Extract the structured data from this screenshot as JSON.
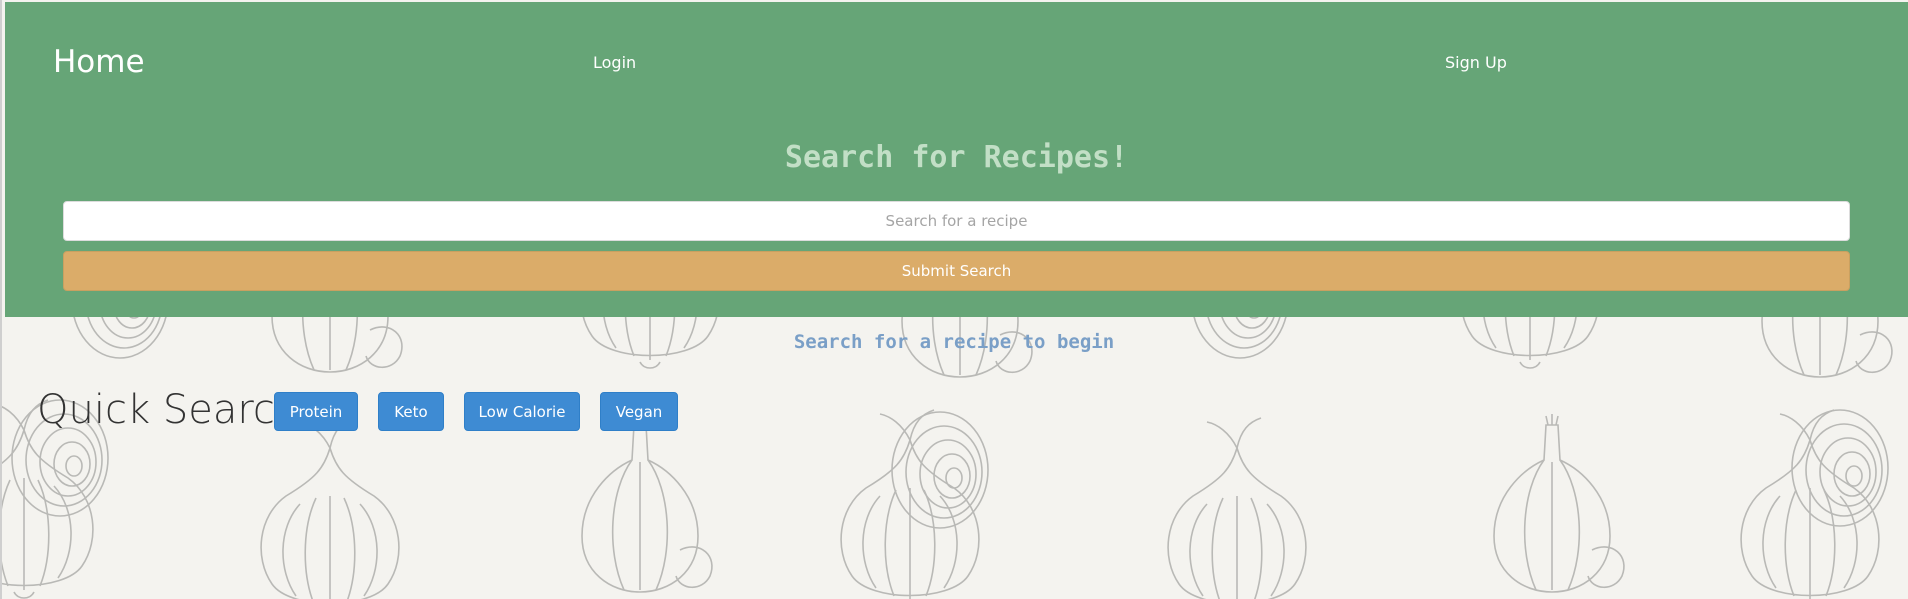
{
  "nav": {
    "brand": "Home",
    "login": "Login",
    "signup": "Sign Up"
  },
  "search": {
    "title": "Search for Recipes!",
    "placeholder": "Search for a recipe",
    "value": "",
    "submit_label": "Submit Search"
  },
  "results": {
    "hint": "Search for a recipe to begin"
  },
  "quick_search": {
    "label": "Quick Search:",
    "buttons": [
      "Protein",
      "Keto",
      "Low Calorie",
      "Vegan"
    ]
  },
  "colors": {
    "header_bg": "#66a577",
    "submit_bg": "#dbac69",
    "quick_btn_bg": "#3e8bd3",
    "page_bg": "#f4f3ef",
    "hint_text": "#7a9fc7"
  },
  "background": {
    "icons": [
      "onion-icon",
      "garlic-icon"
    ]
  }
}
